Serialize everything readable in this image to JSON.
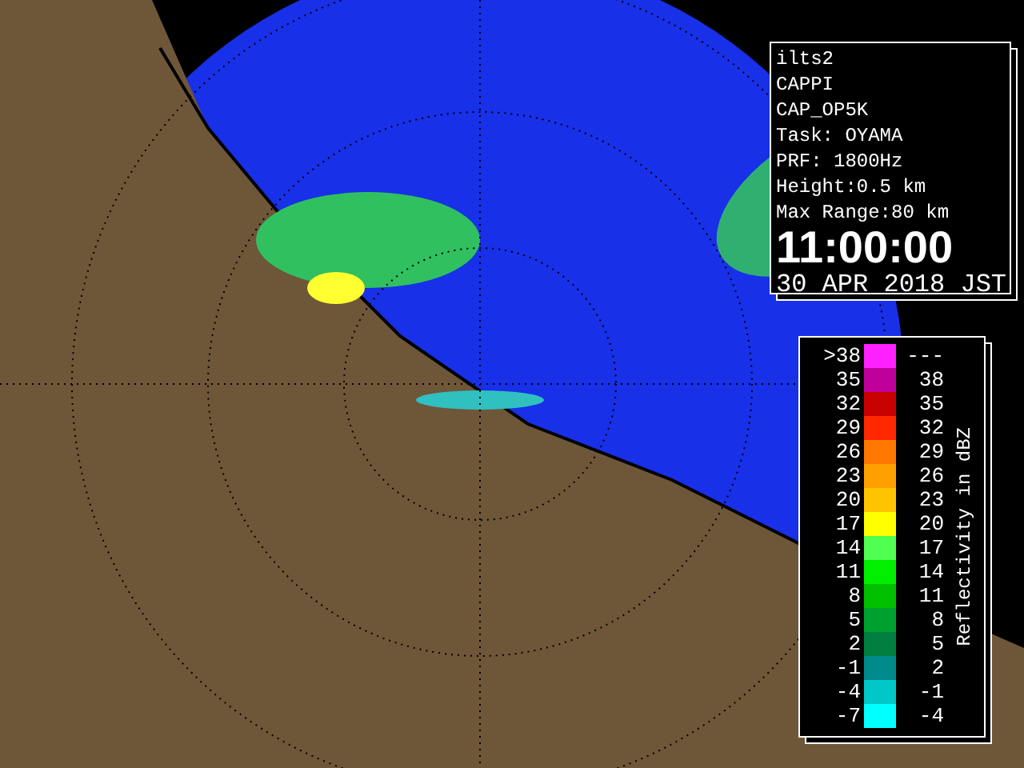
{
  "info_panel": {
    "lines": [
      "ilts2",
      "CAPPI",
      "CAP_OP5K",
      "Task: OYAMA",
      "PRF: 1800Hz",
      "Height:0.5 km",
      "Max Range:80 km"
    ],
    "time": "11:00:00",
    "date": "30 APR 2018 JST"
  },
  "legend": {
    "title": "Reflectivity in dBZ",
    "rows": [
      {
        "low": ">38",
        "high": "---",
        "color": "#ff20ff"
      },
      {
        "low": "35",
        "high": "38",
        "color": "#c0009a"
      },
      {
        "low": "32",
        "high": "35",
        "color": "#c80000"
      },
      {
        "low": "29",
        "high": "32",
        "color": "#ff2800"
      },
      {
        "low": "26",
        "high": "29",
        "color": "#ff7800"
      },
      {
        "low": "23",
        "high": "26",
        "color": "#ffa000"
      },
      {
        "low": "20",
        "high": "23",
        "color": "#ffc400"
      },
      {
        "low": "17",
        "high": "20",
        "color": "#ffff00"
      },
      {
        "low": "14",
        "high": "17",
        "color": "#50ff50"
      },
      {
        "low": "11",
        "high": "14",
        "color": "#00f000"
      },
      {
        "low": "8",
        "high": "11",
        "color": "#00c000"
      },
      {
        "low": "5",
        "high": "8",
        "color": "#00a030"
      },
      {
        "low": "2",
        "high": "5",
        "color": "#008040"
      },
      {
        "low": "-1",
        "high": "2",
        "color": "#008a8a"
      },
      {
        "low": "-4",
        "high": "-1",
        "color": "#00c8c8"
      },
      {
        "low": "-7",
        "high": "-4",
        "color": "#00ffff"
      }
    ]
  }
}
